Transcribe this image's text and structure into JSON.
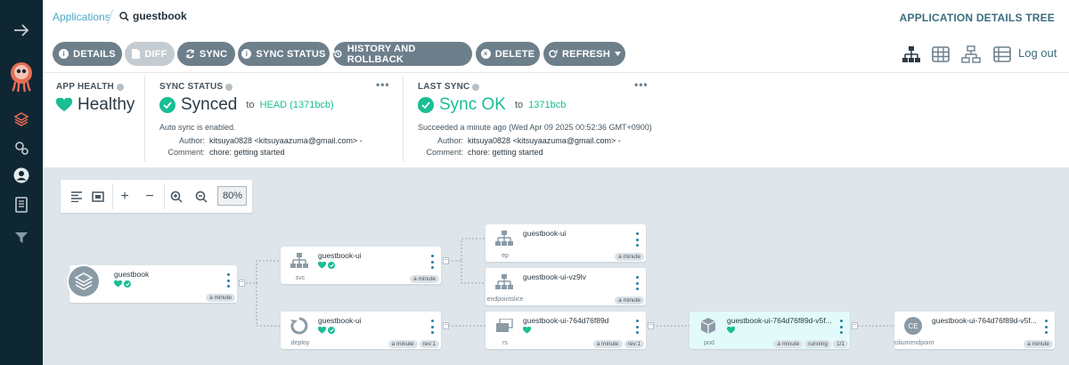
{
  "breadcrumb": {
    "applications": "Applications",
    "current": "guestbook"
  },
  "page_title": "APPLICATION DETAILS TREE",
  "toolbar": {
    "details": "DETAILS",
    "diff": "DIFF",
    "sync": "SYNC",
    "sync_status": "SYNC STATUS",
    "history": "HISTORY AND ROLLBACK",
    "delete": "DELETE",
    "refresh": "REFRESH",
    "logout": "Log out"
  },
  "app_health": {
    "label": "APP HEALTH",
    "value": "Healthy"
  },
  "sync_status": {
    "label": "SYNC STATUS",
    "value": "Synced",
    "to_text": "to",
    "revision": "HEAD (1371bcb)",
    "auto_sync": "Auto sync is enabled.",
    "author_key": "Author:",
    "author": "kitsuya0828 <kitsuyaazuma@gmail.com> -",
    "comment_key": "Comment:",
    "comment": "chore: getting started",
    "more": "•••"
  },
  "last_sync": {
    "label": "LAST SYNC",
    "value": "Sync OK",
    "to_text": "to",
    "revision": "1371bcb",
    "succeeded": "Succeeded a minute ago (Wed Apr 09 2025 00:52:36 GMT+0900)",
    "author_key": "Author:",
    "author": "kitsuya0828 <kitsuyaazuma@gmail.com> -",
    "comment_key": "Comment:",
    "comment": "chore: getting started",
    "more": "•••"
  },
  "graph": {
    "zoom": "80%",
    "nodes": {
      "app": {
        "name": "guestbook",
        "age": "a minute"
      },
      "svc": {
        "name": "guestbook-ui",
        "kind": "svc",
        "age": "a minute"
      },
      "deploy": {
        "name": "guestbook-ui",
        "kind": "deploy",
        "age": "a minute",
        "rev": "rev:1"
      },
      "ep": {
        "name": "guestbook-ui",
        "kind": "ep",
        "age": "a minute"
      },
      "eps": {
        "name": "guestbook-ui-vz9lv",
        "kind": "endpointslice",
        "age": "a minute"
      },
      "rs": {
        "name": "guestbook-ui-764d76f89d",
        "kind": "rs",
        "age": "a minute",
        "rev": "rev:1"
      },
      "pod": {
        "name": "guestbook-ui-764d76f89d-v5f...",
        "kind": "pod",
        "age": "a minute",
        "state": "running",
        "ready": "1/1"
      },
      "ce": {
        "name": "guestbook-ui-764d76f89d-v5f...",
        "kind": "ciliumendpoint",
        "badge": "CE",
        "age": "a minute"
      }
    },
    "collapse_symbol": "−"
  },
  "colors": {
    "sidebar": "#0f2733",
    "button": "#6d7f8b",
    "healthy": "#18be94",
    "link": "#4ba8c5"
  }
}
